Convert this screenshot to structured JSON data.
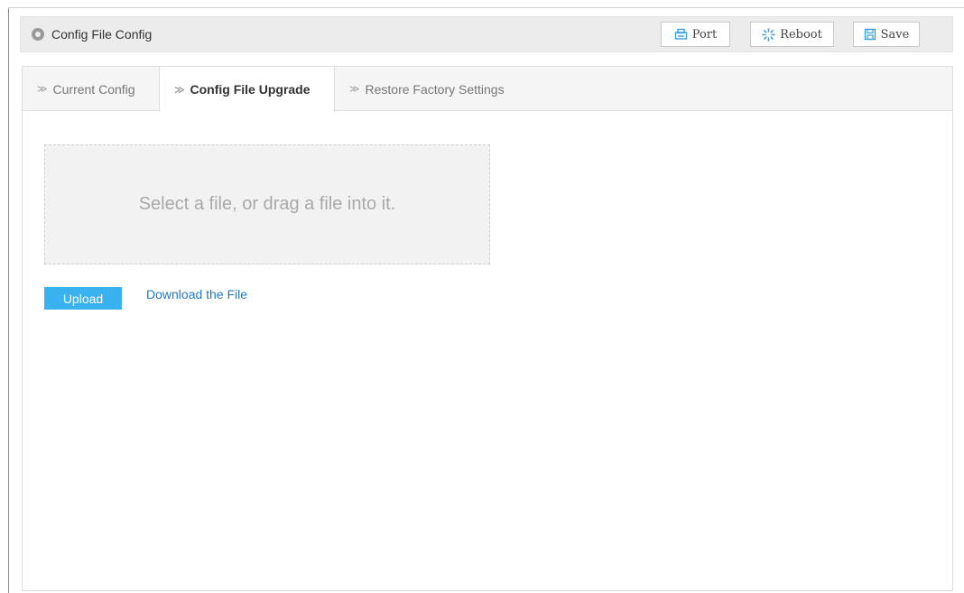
{
  "header": {
    "title": "Config File Config",
    "icon": "location-pin-icon"
  },
  "toolbar": {
    "port_label": "Port",
    "reboot_label": "Reboot",
    "save_label": "Save"
  },
  "tabs": [
    {
      "label": "Current Config",
      "active": false
    },
    {
      "label": "Config File Upgrade",
      "active": true
    },
    {
      "label": "Restore Factory Settings",
      "active": false
    }
  ],
  "upgrade": {
    "dropzone_text": "Select a file, or drag a file into it.",
    "upload_label": "Upload",
    "download_label": "Download the File"
  },
  "colors": {
    "accent": "#3bb2f0",
    "link": "#1f7ac7",
    "reboot_icon": "#3aa0e0"
  }
}
